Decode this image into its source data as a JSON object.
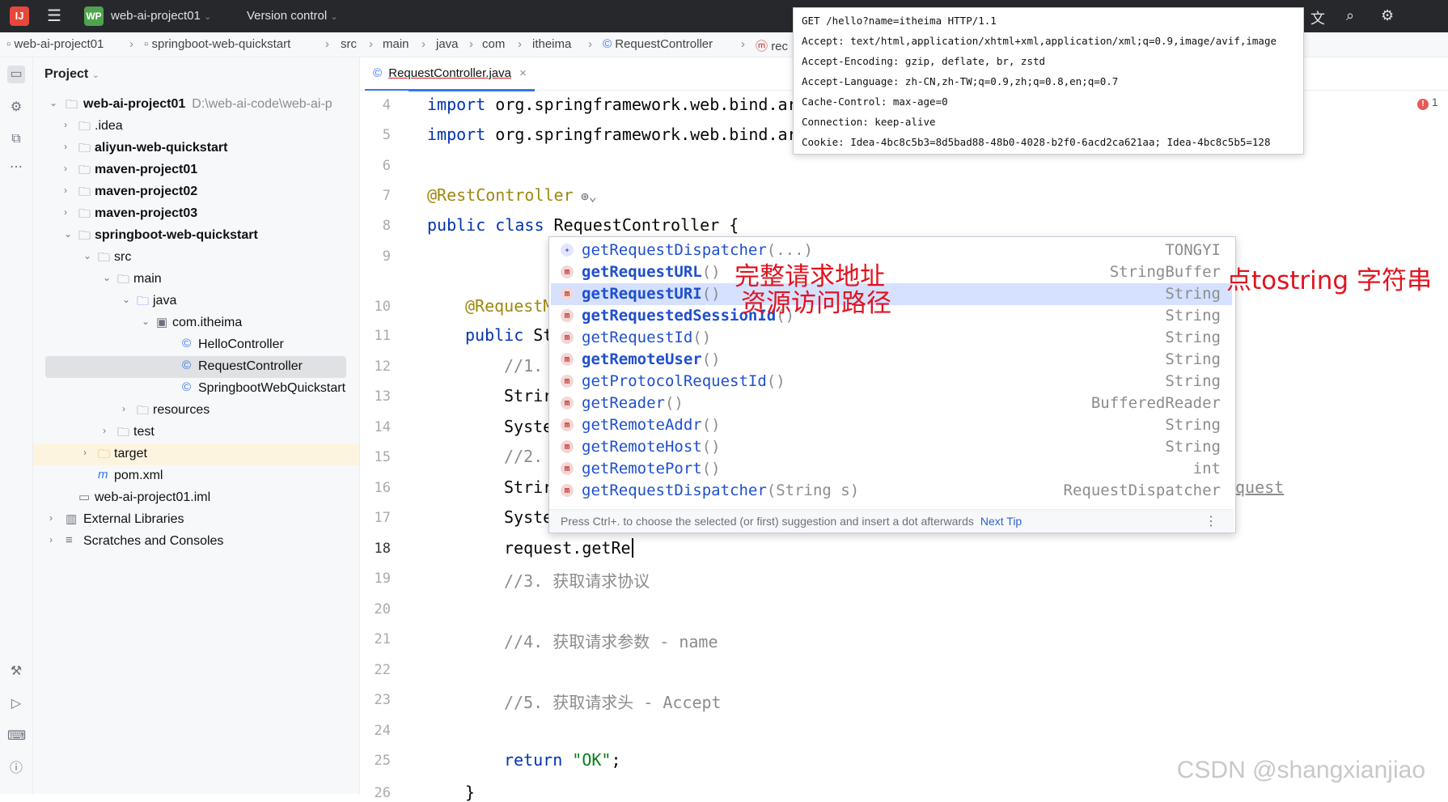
{
  "titlebar": {
    "app_logo": "IJ",
    "project_badge": "WP",
    "project_name": "web-ai-project01",
    "version_control": "Version control",
    "icons": [
      "translate-icon",
      "search-icon",
      "settings-icon"
    ]
  },
  "breadcrumb": {
    "items": [
      "web-ai-project01",
      "springboot-web-quickstart",
      "src",
      "main",
      "java",
      "com",
      "itheima",
      "RequestController",
      "rec"
    ]
  },
  "project_panel": {
    "title": "Project",
    "root_name": "web-ai-project01",
    "root_path": "D:\\web-ai-code\\web-ai-p",
    "items": [
      ".idea",
      "aliyun-web-quickstart",
      "maven-project01",
      "maven-project02",
      "maven-project03",
      "springboot-web-quickstart",
      "src",
      "main",
      "java",
      "com.itheima",
      "HelloController",
      "RequestController",
      "SpringbootWebQuickstart",
      "resources",
      "test",
      "target",
      "pom.xml",
      "web-ai-project01.iml",
      "External Libraries",
      "Scratches and Consoles"
    ]
  },
  "editor": {
    "tab_label": "RequestController.java",
    "error_count": "1",
    "line_numbers": [
      "4",
      "5",
      "6",
      "7",
      "8",
      "9",
      "10",
      "11",
      "12",
      "13",
      "14",
      "15",
      "16",
      "17",
      "18",
      "19",
      "20",
      "21",
      "22",
      "23",
      "24",
      "25",
      "26"
    ],
    "code": {
      "l4_kw": "import",
      "l4_rest": " org.springframework.web.bind.ar",
      "l5_kw": "import",
      "l5_rest": " org.springframework.web.bind.ar",
      "l7": "@RestController",
      "l8_kw": "public class",
      "l8_rest": " RequestController {",
      "l10": "@RequestM",
      "l11_kw": "public",
      "l11_rest": " St",
      "l12": "//1.",
      "l13": "Strir",
      "l14": "Syste",
      "l15": "//2.",
      "l16": "Strir",
      "l16_tail": "quest",
      "l17": "Syste",
      "l18": "request.getRe",
      "l19": "//3. 获取请求协议",
      "l21": "//4. 获取请求参数 - name",
      "l23": "//5. 获取请求头 - Accept",
      "l25_kw": "return",
      "l25_str": " \"OK\"",
      "l25_end": ";",
      "l26": "}"
    }
  },
  "http_tooltip": {
    "lines": [
      "GET /hello?name=itheima HTTP/1.1",
      "Accept: text/html,application/xhtml+xml,application/xml;q=0.9,image/avif,image",
      "Accept-Encoding: gzip, deflate, br, zstd",
      "Accept-Language: zh-CN,zh-TW;q=0.9,zh;q=0.8,en;q=0.7",
      "Cache-Control: max-age=0",
      "Connection: keep-alive",
      "Cookie: Idea-4bc8c5b3=8d5bad88-48b0-4028-b2f0-6acd2ca621aa; Idea-4bc8c5b5=128"
    ]
  },
  "completion": {
    "items": [
      {
        "name": "getRequestDispatcher",
        "args": "(...)",
        "type": "TONGYI"
      },
      {
        "name": "getRequestURL",
        "args": "()",
        "type": "StringBuffer"
      },
      {
        "name": "getRequestURI",
        "args": "()",
        "type": "String"
      },
      {
        "name": "getRequestedSessionId",
        "args": "()",
        "type": "String"
      },
      {
        "name": "getRequestId",
        "args": "()",
        "type": "String"
      },
      {
        "name": "getRemoteUser",
        "args": "()",
        "type": "String"
      },
      {
        "name": "getProtocolRequestId",
        "args": "()",
        "type": "String"
      },
      {
        "name": "getReader",
        "args": "()",
        "type": "BufferedReader"
      },
      {
        "name": "getRemoteAddr",
        "args": "()",
        "type": "String"
      },
      {
        "name": "getRemoteHost",
        "args": "()",
        "type": "String"
      },
      {
        "name": "getRemotePort",
        "args": "()",
        "type": "int"
      },
      {
        "name": "getRequestDispatcher",
        "args": "(String s)",
        "type": "RequestDispatcher"
      }
    ],
    "footer": "Press Ctrl+. to choose the selected (or first) suggestion and insert a dot afterwards",
    "next_tip": "Next Tip"
  },
  "annotations": {
    "url_note": "完整请求地址",
    "uri_note": "资源访问路径",
    "tostring_note": "点tostring 字符串"
  },
  "watermark": "CSDN @shangxianjiao"
}
